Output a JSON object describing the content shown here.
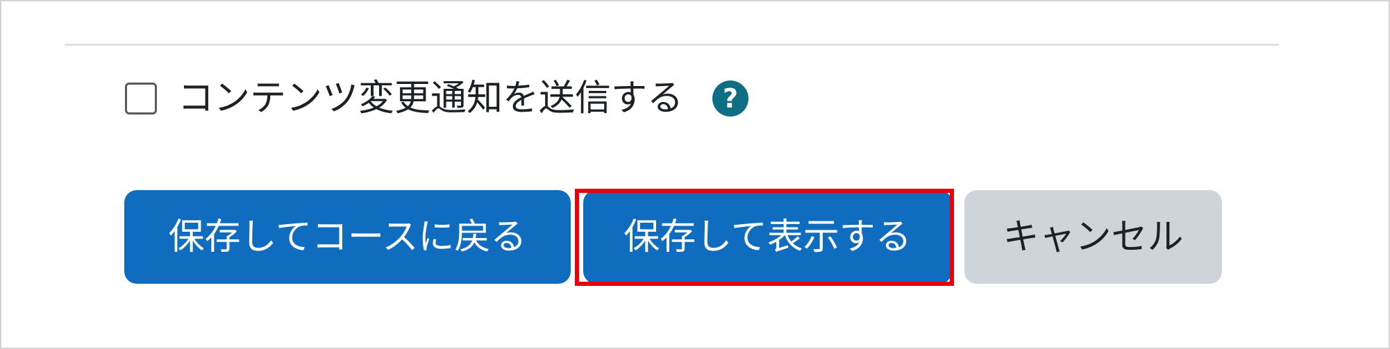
{
  "form": {
    "notify_checkbox": {
      "label": "コンテンツ変更通知を送信する",
      "checked": false
    },
    "help_icon": {
      "glyph": "?",
      "icon": "question-circle-icon",
      "color": "#0f6e84"
    },
    "buttons": {
      "save_return_label": "保存してコースに戻る",
      "save_display_label": "保存して表示する",
      "cancel_label": "キャンセル"
    }
  },
  "colors": {
    "primary": "#0f6cbf",
    "secondary": "#ced4da",
    "highlight": "#e8000a"
  }
}
